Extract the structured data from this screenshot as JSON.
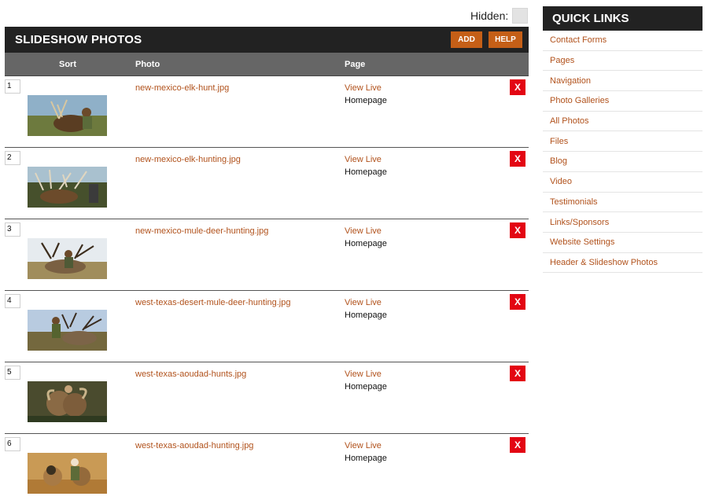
{
  "hidden": {
    "label": "Hidden:"
  },
  "main": {
    "title": "SLIDESHOW PHOTOS",
    "add_label": "ADD",
    "help_label": "HELP",
    "columns": {
      "sort": "Sort",
      "photo": "Photo",
      "page": "Page"
    },
    "rows": [
      {
        "sort": "1",
        "photo": "new-mexico-elk-hunt.jpg",
        "view_live": "View Live",
        "page": "Homepage",
        "delete": "X",
        "thumb_icon": "elk-hunt-photo"
      },
      {
        "sort": "2",
        "photo": "new-mexico-elk-hunting.jpg",
        "view_live": "View Live",
        "page": "Homepage",
        "delete": "X",
        "thumb_icon": "elk-hunting-photo"
      },
      {
        "sort": "3",
        "photo": "new-mexico-mule-deer-hunting.jpg",
        "view_live": "View Live",
        "page": "Homepage",
        "delete": "X",
        "thumb_icon": "mule-deer-photo"
      },
      {
        "sort": "4",
        "photo": "west-texas-desert-mule-deer-hunting.jpg",
        "view_live": "View Live",
        "page": "Homepage",
        "delete": "X",
        "thumb_icon": "desert-mule-deer-photo"
      },
      {
        "sort": "5",
        "photo": "west-texas-aoudad-hunts.jpg",
        "view_live": "View Live",
        "page": "Homepage",
        "delete": "X",
        "thumb_icon": "aoudad-hunt-photo"
      },
      {
        "sort": "6",
        "photo": "west-texas-aoudad-hunting.jpg",
        "view_live": "View Live",
        "page": "Homepage",
        "delete": "X",
        "thumb_icon": "aoudad-hunting-photo"
      }
    ]
  },
  "quick_links": {
    "title": "QUICK LINKS",
    "items": [
      "Contact Forms",
      "Pages",
      "Navigation",
      "Photo Galleries",
      "All Photos",
      "Files",
      "Blog",
      "Video",
      "Testimonials",
      "Links/Sponsors",
      "Website Settings",
      "Header & Slideshow Photos"
    ]
  },
  "colors": {
    "header_bg": "#222222",
    "column_header_bg": "#666666",
    "accent_orange": "#c55f17",
    "link_color": "#b1521c",
    "delete_red": "#e30613"
  }
}
